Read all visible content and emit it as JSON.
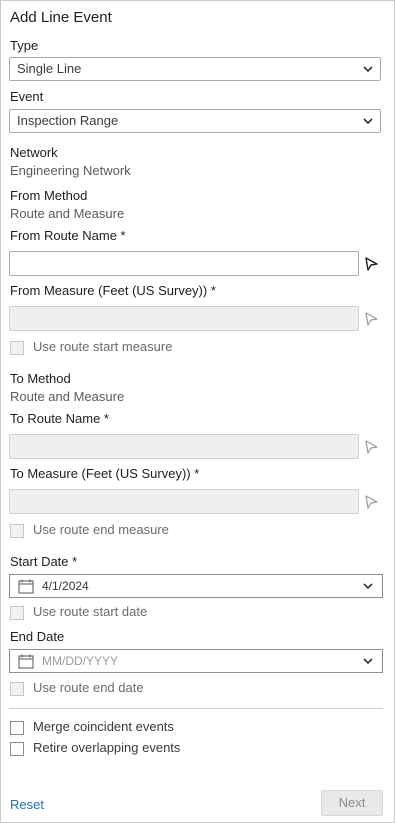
{
  "panel_title": "Add Line Event",
  "type": {
    "label": "Type",
    "value": "Single Line"
  },
  "event": {
    "label": "Event",
    "value": "Inspection Range"
  },
  "network": {
    "label": "Network",
    "value": "Engineering Network"
  },
  "from_method": {
    "label": "From Method",
    "value": "Route and Measure"
  },
  "from_route": {
    "label": "From Route Name *",
    "value": ""
  },
  "from_measure": {
    "label": "From Measure (Feet (US Survey)) *",
    "checkbox_label": "Use route start measure"
  },
  "to_method": {
    "label": "To Method",
    "value": "Route and Measure"
  },
  "to_route": {
    "label": "To Route Name *"
  },
  "to_measure": {
    "label": "To Measure (Feet (US Survey)) *",
    "checkbox_label": "Use route end measure"
  },
  "start_date": {
    "label": "Start Date *",
    "value": "4/1/2024",
    "checkbox_label": "Use route start date"
  },
  "end_date": {
    "label": "End Date",
    "placeholder": "MM/DD/YYYY",
    "checkbox_label": "Use route end date"
  },
  "options": {
    "merge_label": "Merge coincident events",
    "retire_label": "Retire overlapping events"
  },
  "footer": {
    "reset_label": "Reset",
    "next_label": "Next"
  },
  "icons": {
    "chevron": "chevron-down-icon",
    "picker": "map-pointer-icon",
    "calendar": "calendar-icon"
  },
  "colors": {
    "link": "#1f6fb4",
    "border": "#aaaaaa",
    "disabled_bg": "#efefef"
  }
}
